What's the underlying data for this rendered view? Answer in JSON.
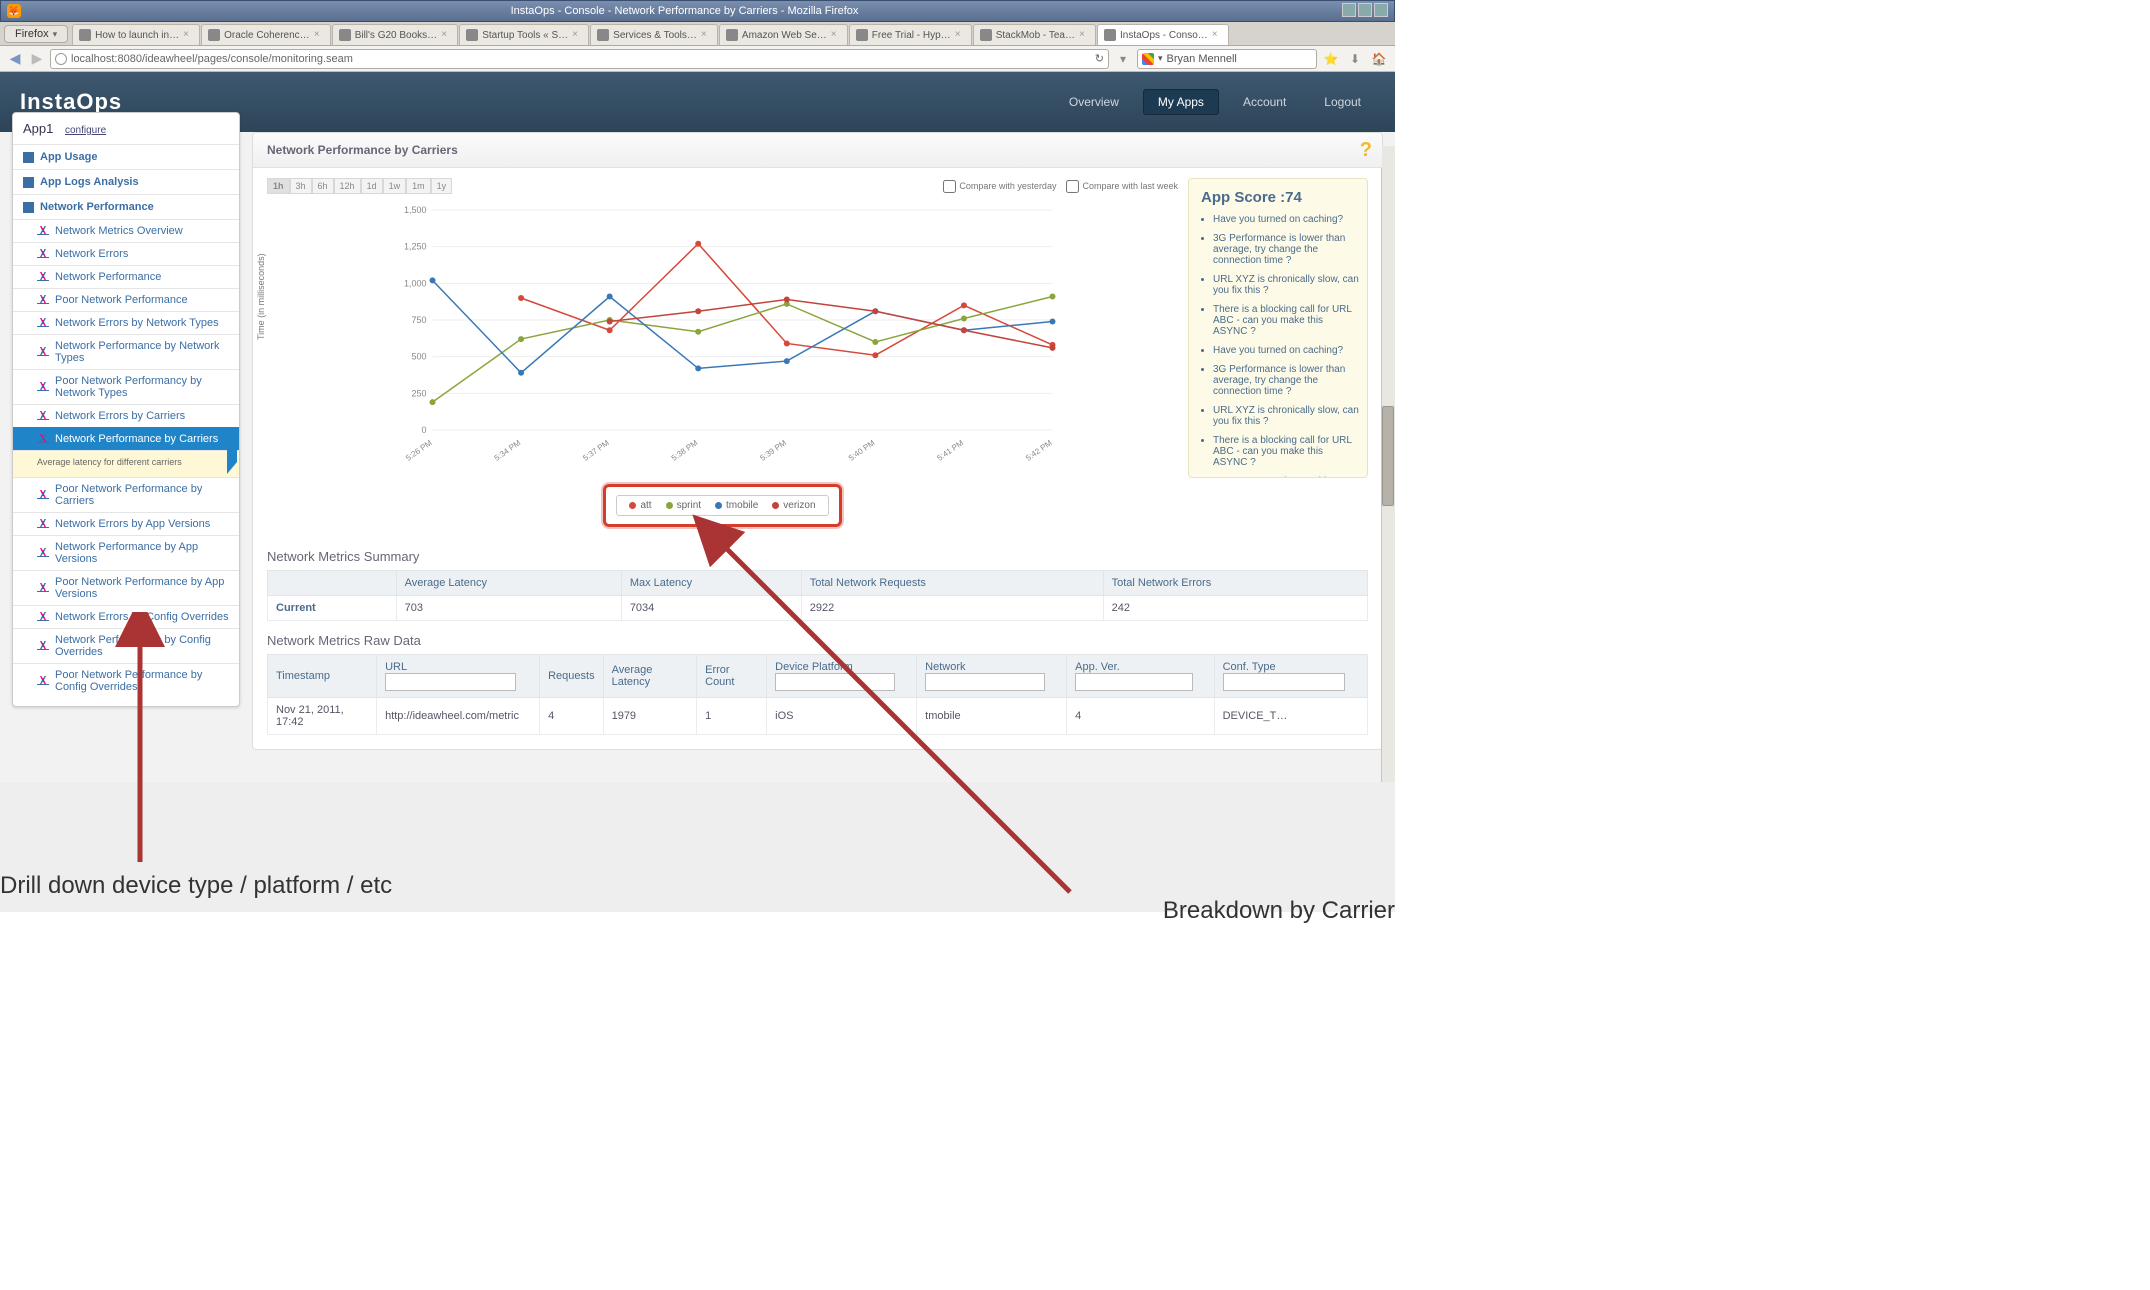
{
  "window": {
    "title": "InstaOps - Console - Network Performance by Carriers - Mozilla Firefox",
    "browser_label": "Firefox",
    "tabs": [
      "How to launch in…",
      "Oracle Coherenc…",
      "Bill's G20 Books…",
      "Startup Tools « S…",
      "Services & Tools…",
      "Amazon Web Se…",
      "Free Trial - Hyp…",
      "StackMob - Tea…",
      "InstaOps - Conso…"
    ],
    "active_tab": 8,
    "url": "localhost:8080/ideawheel/pages/console/monitoring.seam",
    "search_value": "Bryan Mennell"
  },
  "brand": "InstaOps",
  "topnav": {
    "items": [
      "Overview",
      "My Apps",
      "Account",
      "Logout"
    ],
    "active": "My Apps"
  },
  "appselector": {
    "name": "App1",
    "configure": "configure"
  },
  "sidebar": {
    "groups": [
      {
        "label": "App Usage"
      },
      {
        "label": "App Logs Analysis"
      },
      {
        "label": "Network Performance"
      }
    ],
    "items": [
      "Network Metrics Overview",
      "Network Errors",
      "Network Performance",
      "Poor Network Performance",
      "Network Errors by Network Types",
      "Network Performance by Network Types",
      "Poor Network Performancy by Network Types",
      "Network Errors by Carriers",
      "Network Performance by Carriers",
      "Poor Network Performance by Carriers",
      "Network Errors by App Versions",
      "Network Performance by App Versions",
      "Poor Network Performance by App Versions",
      "Network Errors by Config Overrides",
      "Network Performance by Config Overrides",
      "Poor Network Performance by Config Overrides"
    ],
    "active_index": 8,
    "active_note": "Average latency for different carriers"
  },
  "panel_title": "Network Performance by Carriers",
  "time_ranges": [
    "1h",
    "3h",
    "6h",
    "12h",
    "1d",
    "1w",
    "1m",
    "1y"
  ],
  "time_active": "1h",
  "compare_labels": {
    "yesterday": "Compare with yesterday",
    "lastweek": "Compare with last week"
  },
  "chart_data": {
    "type": "line",
    "title": "",
    "ylabel": "Time (in milliseconds)",
    "xlabel": "",
    "ylim": [
      0,
      1500
    ],
    "yticks": [
      0,
      250,
      500,
      750,
      1000,
      1250,
      1500
    ],
    "categories": [
      "5:26 PM",
      "5:34 PM",
      "5:37 PM",
      "5:38 PM",
      "5:39 PM",
      "5:40 PM",
      "5:41 PM",
      "5:42 PM"
    ],
    "series": [
      {
        "name": "att",
        "color": "#d6483b",
        "values": [
          null,
          900,
          680,
          1270,
          590,
          510,
          850,
          580
        ]
      },
      {
        "name": "sprint",
        "color": "#8aa53c",
        "values": [
          190,
          620,
          750,
          670,
          860,
          600,
          760,
          910
        ]
      },
      {
        "name": "tmobile",
        "color": "#3a78b5",
        "values": [
          1020,
          390,
          910,
          420,
          470,
          810,
          680,
          740
        ]
      },
      {
        "name": "verizon",
        "color": "#c2443a",
        "values": [
          null,
          null,
          740,
          810,
          890,
          810,
          680,
          560
        ]
      }
    ],
    "legend": [
      "att",
      "sprint",
      "tmobile",
      "verizon"
    ]
  },
  "score": {
    "title": "App Score :74",
    "tips": [
      "Have you turned on caching?",
      "3G Performance is lower than average, try change the connection time ?",
      "URL XYZ is chronically slow, can you fix this ?",
      "There is a blocking call for URL ABC - can you make this ASYNC ?",
      "Have you turned on caching?",
      "3G Performance is lower than average, try change the connection time ?",
      "URL XYZ is chronically slow, can you fix this ?",
      "There is a blocking call for URL ABC - can you make this ASYNC ?",
      "Have you turned on caching?"
    ]
  },
  "summary": {
    "title": "Network Metrics Summary",
    "cols": [
      "",
      "Average Latency",
      "Max Latency",
      "Total Network Requests",
      "Total Network Errors"
    ],
    "row_label": "Current",
    "row": [
      "703",
      "7034",
      "2922",
      "242"
    ]
  },
  "raw": {
    "title": "Network Metrics Raw Data",
    "cols": [
      "Timestamp",
      "URL",
      "Requests",
      "Average Latency",
      "Error Count",
      "Device Platform",
      "Network",
      "App. Ver.",
      "Conf. Type"
    ],
    "filter_cols": [
      1,
      5,
      6,
      7,
      8
    ],
    "rows": [
      {
        "ts": "Nov 21, 2011, 17:42",
        "url": "http://ideawheel.com/metric",
        "req": "4",
        "lat": "1979",
        "err": "1",
        "plat": "iOS",
        "net": "tmobile",
        "ver": "4",
        "conf": "DEVICE_T…"
      }
    ]
  },
  "annotations": {
    "left": "Drill down device type / platform / etc",
    "right": "Breakdown by Carrier"
  }
}
